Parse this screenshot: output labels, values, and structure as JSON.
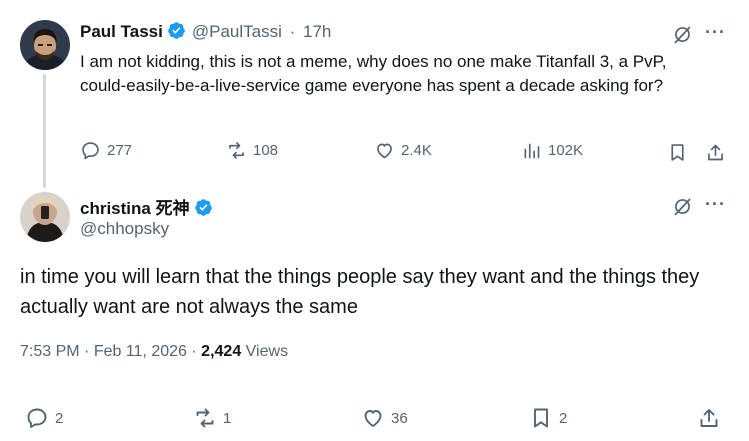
{
  "parent_tweet": {
    "author_name": "Paul Tassi",
    "handle": "@PaulTassi",
    "separator": "·",
    "time_ago": "17h",
    "text": "I am not kidding, this is not a meme, why does no one make Titanfall 3, a PvP, could-easily-be-a-live-service game everyone has spent a decade asking for?",
    "stats": {
      "replies": "277",
      "reposts": "108",
      "likes": "2.4K",
      "views": "102K"
    },
    "icons": {
      "grok": "grok-icon",
      "more": "more-icon",
      "reply": "reply-icon",
      "repost": "repost-icon",
      "like": "like-icon",
      "views": "views-icon",
      "bookmark": "bookmark-icon",
      "share": "share-icon"
    },
    "more_label": "···"
  },
  "main_tweet": {
    "author_name": "christina 死神",
    "handle": "@chhopsky",
    "text": "in time you will learn that the things people say they want and the things they actually want are not always the same",
    "time": "7:53 PM",
    "date": "Feb 11, 2026",
    "separator": "·",
    "views_count": "2,424",
    "views_label": "Views",
    "stats": {
      "replies": "2",
      "reposts": "1",
      "likes": "36",
      "bookmarks": "2"
    },
    "more_label": "···"
  },
  "colors": {
    "verified": "#1d9bf0",
    "muted": "#536471",
    "text": "#0f1419",
    "thread_line": "#cfd9de"
  }
}
